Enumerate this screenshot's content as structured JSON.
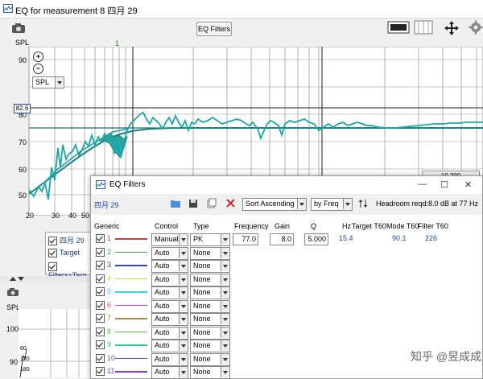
{
  "window": {
    "title": "EQ for measurement 8 四月 29"
  },
  "toolbar": {
    "eq_filters_label": "EQ Filters",
    "icons": [
      "camera-icon",
      "graph-layout-icon",
      "frame-icon",
      "move-arrows-icon",
      "gear-icon"
    ]
  },
  "graph": {
    "y_axis_label": "SPL",
    "marker_label": "1",
    "y_ticks": [
      "90",
      "80",
      "70",
      "60",
      "50"
    ],
    "x_ticks": [
      "20",
      "30",
      "40",
      "50"
    ],
    "cursor_value": "82.6",
    "spl_selector": "SPL",
    "range_readout": "10   200"
  },
  "legend": {
    "items": [
      {
        "label": "四月 29"
      },
      {
        "label": "Target"
      },
      {
        "label": "Filters+Targ"
      }
    ]
  },
  "lower_panel": {
    "y_axis_label": "SPL",
    "y_ticks": [
      "100",
      "90"
    ],
    "small_ticks": [
      "60",
      "120",
      "180"
    ]
  },
  "eq_window": {
    "title": "EQ Filters",
    "measurement_name": "四月 29",
    "sort_option": "Sort Ascending",
    "by_option": "by Freq",
    "headroom_label": "Headroom reqd:",
    "headroom_value": "8.0 dB at 77 Hz",
    "columns": {
      "generic": "Generic",
      "control": "Control",
      "type": "Type",
      "frequency": "Frequency",
      "gain": "Gain",
      "q": "Q",
      "hz": "Hz",
      "target_t60": "Target T60",
      "mode_t60": "Mode T60",
      "filter_t60": "Filter T60"
    },
    "filters": [
      {
        "num": "1",
        "control": "Manual",
        "type": "PK",
        "frequency": "77.0",
        "gain": "8.0",
        "q": "5.000",
        "hz": "15.4",
        "mode_t60": "90.1",
        "filter_t60": "226",
        "color": "#d23a3a"
      },
      {
        "num": "2",
        "control": "Auto",
        "type": "None",
        "color": "#34a853"
      },
      {
        "num": "3",
        "control": "Auto",
        "type": "None",
        "color": "#3344c8"
      },
      {
        "num": "4",
        "control": "Auto",
        "type": "None",
        "color": "#e2d23a"
      },
      {
        "num": "5",
        "control": "Auto",
        "type": "None",
        "color": "#3ad2e2"
      },
      {
        "num": "6",
        "control": "Auto",
        "type": "None",
        "color": "#d23ad2"
      },
      {
        "num": "7",
        "control": "Auto",
        "type": "None",
        "color": "#b8843a"
      },
      {
        "num": "8",
        "control": "Auto",
        "type": "None",
        "color": "#6ac248"
      },
      {
        "num": "9",
        "control": "Auto",
        "type": "None",
        "color": "#3ac2a0"
      },
      {
        "num": "10",
        "control": "Auto",
        "type": "None",
        "color": "#4a6ad2"
      },
      {
        "num": "11",
        "control": "Auto",
        "type": "None",
        "color": "#8a3ad2"
      }
    ]
  },
  "watermark": "知乎 @昱成成"
}
